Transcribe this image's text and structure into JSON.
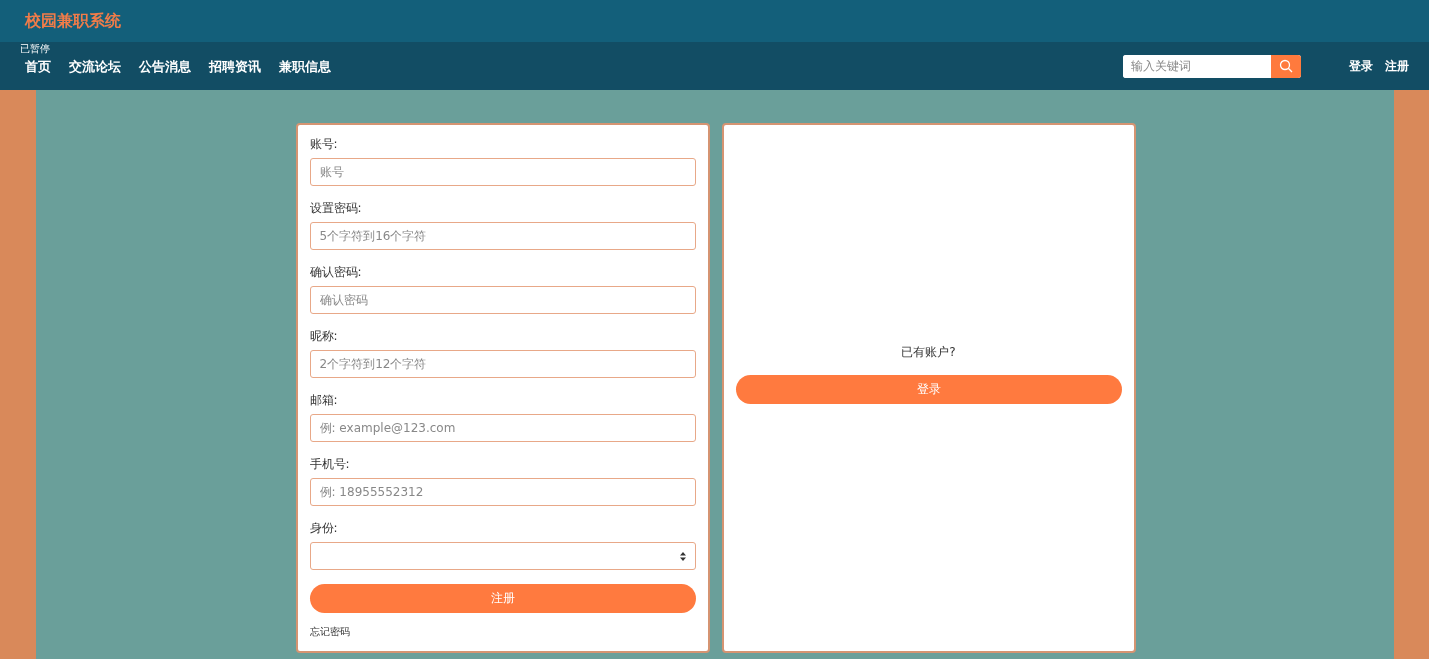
{
  "header": {
    "title": "校园兼职系统"
  },
  "overlay_status": "已暂停",
  "nav": {
    "items": [
      {
        "label": "首页"
      },
      {
        "label": "交流论坛"
      },
      {
        "label": "公告消息"
      },
      {
        "label": "招聘资讯"
      },
      {
        "label": "兼职信息"
      }
    ],
    "search": {
      "placeholder": "输入关键词"
    },
    "links": [
      "登录",
      "注册"
    ]
  },
  "register_form": {
    "fields": [
      {
        "kind": "text",
        "label": "账号:",
        "placeholder": "账号"
      },
      {
        "kind": "text",
        "label": "设置密码:",
        "placeholder": "5个字符到16个字符"
      },
      {
        "kind": "text",
        "label": "确认密码:",
        "placeholder": "确认密码"
      },
      {
        "kind": "text",
        "label": "昵称:",
        "placeholder": "2个字符到12个字符"
      },
      {
        "kind": "text",
        "label": "邮箱:",
        "placeholder": "例: example@123.com"
      },
      {
        "kind": "text",
        "label": "手机号:",
        "placeholder": "例: 18955552312"
      },
      {
        "kind": "select",
        "label": "身份:"
      }
    ],
    "submit": "注册",
    "forgot_link": "忘记密码"
  },
  "login_panel": {
    "prompt": "已有账户?",
    "button": "登录"
  }
}
